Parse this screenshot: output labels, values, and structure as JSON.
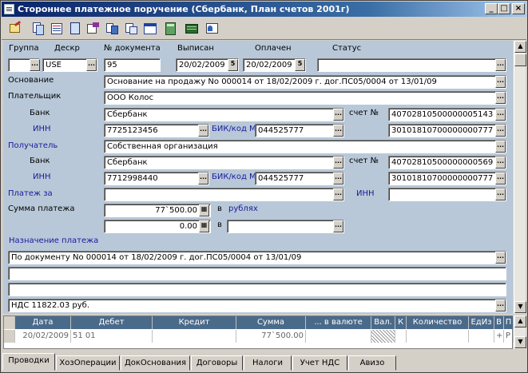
{
  "window": {
    "title": "Стороннее платежное поручение (Сбербанк, План счетов 2001г)",
    "min": "_",
    "max": "□",
    "close": "×"
  },
  "labels": {
    "group": "Группа",
    "deskr": "Дескр",
    "doc_num": "№ документа",
    "issued": "Выписан",
    "paid": "Оплачен",
    "status": "Статус",
    "basis": "Основание",
    "payer": "Плательщик",
    "bank": "Банк",
    "account": "счет №",
    "inn": "ИНН",
    "bik": "БИК/код М",
    "recipient": "Получатель",
    "payment_for": "Платеж за",
    "amount": "Сумма платежа",
    "in": "в",
    "rubles": "рублях",
    "purpose": "Назначение платежа"
  },
  "fields": {
    "group": "",
    "deskr": "USE",
    "doc_num": "95",
    "issued": "20/02/2009",
    "paid": "20/02/2009",
    "status": "",
    "basis": "Основание на продажу No 000014 от 18/02/2009 г. дог.ПС05/0004 от 13/01/09",
    "payer": "ООО Колос",
    "payer_bank": "Сбербанк",
    "payer_account": "40702810500000005143",
    "payer_inn": "7725123456",
    "payer_bik": "044525777",
    "payer_corr": "30101810700000000777",
    "recipient": "Собственная организация",
    "rec_bank": "Сбербанк",
    "rec_account": "40702810500000000569",
    "rec_inn": "7712998440",
    "rec_bik": "044525777",
    "rec_corr": "30101810700000000777",
    "payment_for": "",
    "payment_for_inn": "",
    "amount": "77`500.00",
    "amount2": "0.00",
    "currency2": "",
    "purpose1": "По документу No 000014 от 18/02/2009 г. дог.ПС05/0004 от 13/01/09",
    "purpose2": "",
    "purpose3": "",
    "purpose4": "НДС 11822.03 руб."
  },
  "grid": {
    "headers": [
      "Дата",
      "Дебет",
      "Кредит",
      "Сумма",
      "... в валюте",
      "Вал.",
      "К",
      "Количество",
      "ЕдИз",
      "В",
      "П"
    ],
    "rows": [
      [
        "20/02/2009",
        "51 01",
        "",
        "77`500.00",
        "",
        "",
        "",
        "",
        "",
        "+",
        "Р"
      ]
    ]
  },
  "tabs": [
    "Проводки",
    "ХозОперации",
    "ДокОснования",
    "Договоры",
    "Налоги",
    "Учет НДС",
    "Авизо"
  ]
}
